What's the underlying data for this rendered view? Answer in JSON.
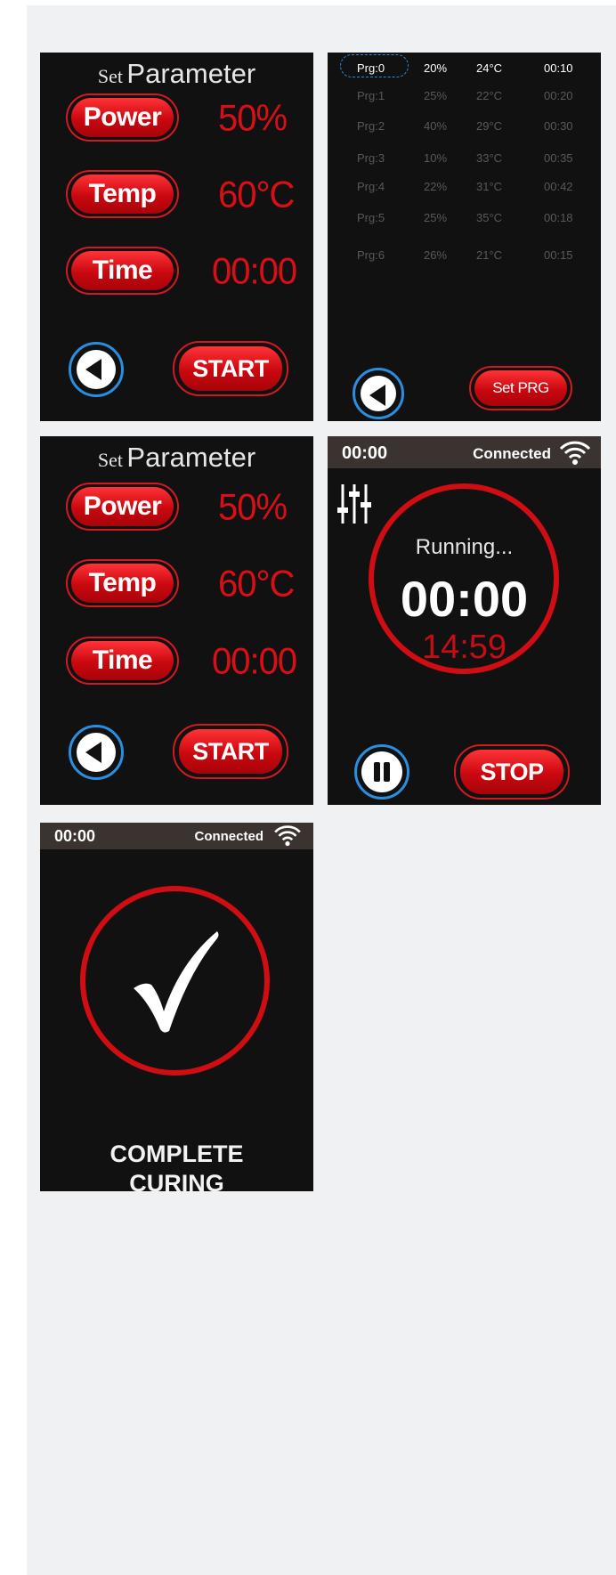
{
  "set_parameter_screen": {
    "title_small": "Set",
    "title_big": "Parameter",
    "power_label": "Power",
    "power_value": "50%",
    "temp_label": "Temp",
    "temp_value": "60°C",
    "time_label": "Time",
    "time_value": "00:00",
    "back_icon": "back-arrow-icon",
    "start_label": "START"
  },
  "program_screen": {
    "rows": [
      {
        "prg": "Prg:0",
        "power": "20%",
        "temp": "24°C",
        "time": "00:10",
        "selected": true
      },
      {
        "prg": "Prg:1",
        "power": "25%",
        "temp": "22°C",
        "time": "00:20",
        "selected": false
      },
      {
        "prg": "Prg:2",
        "power": "40%",
        "temp": "29°C",
        "time": "00:30",
        "selected": false
      },
      {
        "prg": "Prg:3",
        "power": "10%",
        "temp": "33°C",
        "time": "00:35",
        "selected": false
      },
      {
        "prg": "Prg:4",
        "power": "22%",
        "temp": "31°C",
        "time": "00:42",
        "selected": false
      },
      {
        "prg": "Prg:5",
        "power": "25%",
        "temp": "35°C",
        "time": "00:18",
        "selected": false
      },
      {
        "prg": "Prg:6",
        "power": "26%",
        "temp": "21°C",
        "time": "00:15",
        "selected": false
      }
    ],
    "set_prg_label": "Set PRG"
  },
  "running_screen": {
    "clock": "00:00",
    "connection": "Connected",
    "status": "Running...",
    "elapsed": "00:00",
    "remaining": "14:59",
    "stop_label": "STOP"
  },
  "complete_screen": {
    "clock": "00:00",
    "connection": "Connected",
    "message_line1": "COMPLETE",
    "message_line2": "CURING"
  },
  "colors": {
    "accent_red": "#d10d14",
    "accent_blue": "#2a8ee0",
    "panel_bg": "#111111",
    "page_bg": "#f0f1f3"
  }
}
